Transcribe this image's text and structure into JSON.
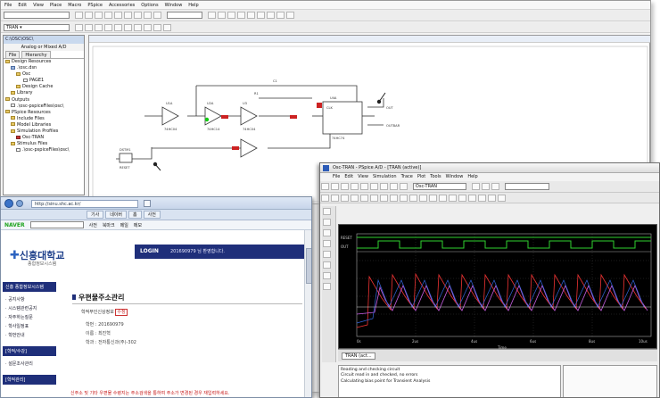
{
  "capture": {
    "menu": [
      "File",
      "Edit",
      "View",
      "Place",
      "Macro",
      "PSpice",
      "Accessories",
      "Options",
      "Window",
      "Help"
    ],
    "sim_profile": "TRAN",
    "project": {
      "title": "C:\\OSC\\OSC\\",
      "subtitle": "Analog or Mixed A/D",
      "tabs": [
        "File",
        "Hierarchy"
      ],
      "tree": [
        "Design Resources",
        ".\\osc.dsn",
        "Osc",
        "PAGE1",
        "Design Cache",
        "Library",
        "Outputs",
        ".\\osc-pspiceFiles\\osc\\",
        "PSpice Resources",
        "Include Files",
        "Model Libraries",
        "Simulation Profiles",
        "Osc-TRAN",
        "Stimulus Files",
        ".\\osc-pspiceFiles\\osc\\"
      ]
    },
    "schematic": {
      "labels": [
        "U1A",
        "74HC04",
        "U2A",
        "74HC14",
        "R1",
        "C1",
        "U3",
        "74HC04",
        "U4A",
        "74HC74",
        "DSTM1",
        "RESET",
        "CLK",
        "OUT",
        "OUTBAR"
      ]
    }
  },
  "browser": {
    "address": "http://sinu.shc.ac.kr/",
    "tabs": [
      "기사",
      "네이버",
      "홈",
      "사전"
    ],
    "toolbar": [
      "NAVER",
      "사전",
      "북마크",
      "메일",
      "메모"
    ],
    "logo": "신흥대학교",
    "logo_sub": "종합정보시스템",
    "login_label": "LOGIN",
    "login_msg": "201690979 님 환영합니다.",
    "left_nav": {
      "section1": "신흥 종합정보시스템",
      "items1": [
        "공지사항",
        "시스템관련공지",
        "자주하는질문",
        "학사일정표",
        "학번안내"
      ],
      "section2": "[학적/수강]",
      "items2": [
        "설문조사관리"
      ],
      "section3": "[학적관리]"
    },
    "page_title": "우편물주소관리",
    "sub_title": "학적부인신상정보",
    "fields": [
      {
        "label": "학번",
        "value": "201690979"
      },
      {
        "label": "이름",
        "value": "최진혁"
      },
      {
        "label": "학과",
        "value": "전자통신과(주)-302"
      }
    ],
    "notice": "신주소 및 기타 우편물 수령지는 주소검색을 통하여 주소가 변경된 경우 재입력하세요."
  },
  "probe": {
    "title": "Osc-TRAN - PSpice A/D - [TRAN (active)]",
    "menu": [
      "File",
      "Edit",
      "View",
      "Simulation",
      "Trace",
      "Plot",
      "Tools",
      "Window",
      "Help"
    ],
    "profile": "Osc-TRAN",
    "plot_signals": [
      "RESET",
      "OUT"
    ],
    "x_ticks": [
      "0s",
      "2us",
      "4us",
      "6us",
      "8us",
      "10us"
    ],
    "x_label": "Time",
    "status_tab": "TRAN (act...",
    "log": [
      "Reading and checking circuit",
      "Circuit read in and checked, no errors",
      "Calculating bias point for Transient Analysis"
    ]
  }
}
